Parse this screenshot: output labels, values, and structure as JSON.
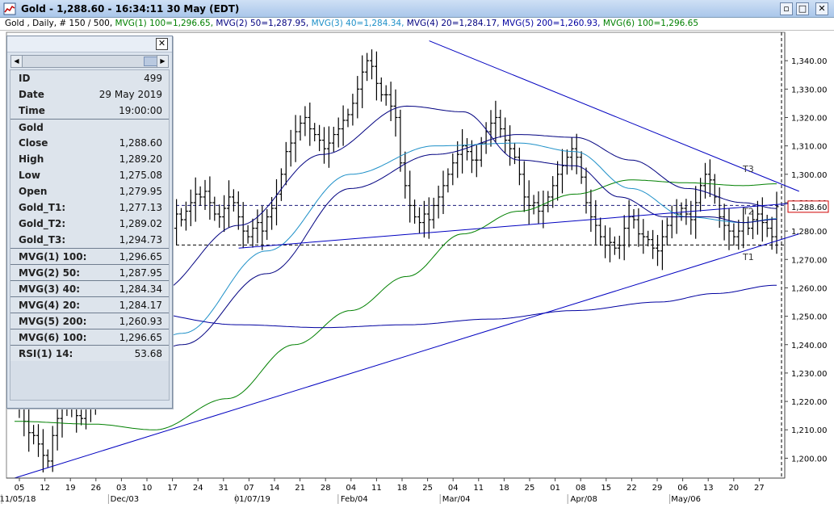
{
  "window": {
    "title": "Gold - 1,288.60 - 16:34:11  30 May (EDT)"
  },
  "legend": [
    {
      "text": "Gold , Daily, # 150 / 500, ",
      "color": "#000000"
    },
    {
      "text": "MVG(1) 100=1,296.65, ",
      "color": "#008000"
    },
    {
      "text": "MVG(2) 50=1,287.95, ",
      "color": "#000080"
    },
    {
      "text": "MVG(3) 40=1,284.34, ",
      "color": "#1e90c8"
    },
    {
      "text": "MVG(4) 20=1,284.17, ",
      "color": "#000080"
    },
    {
      "text": "MVG(5) 200=1,260.93, ",
      "color": "#0000a0"
    },
    {
      "text": "MVG(6) 100=1,296.65",
      "color": "#008000"
    }
  ],
  "data_window": {
    "rows": [
      {
        "label": "ID",
        "value": "499"
      },
      {
        "label": "Date",
        "value": "29 May 2019"
      },
      {
        "label": "Time",
        "value": "19:00:00"
      },
      {
        "label": "Gold",
        "value": "",
        "sep": true
      },
      {
        "label": "Close",
        "value": "1,288.60"
      },
      {
        "label": "High",
        "value": "1,289.20"
      },
      {
        "label": "Low",
        "value": "1,275.08"
      },
      {
        "label": "Open",
        "value": "1,279.95"
      },
      {
        "label": "Gold_T1:",
        "value": "1,277.13"
      },
      {
        "label": "Gold_T2:",
        "value": "1,289.02"
      },
      {
        "label": "Gold_T3:",
        "value": "1,294.73"
      },
      {
        "label": "MVG(1) 100:",
        "value": "1,296.65",
        "sep": true
      },
      {
        "label": "MVG(2) 50:",
        "value": "1,287.95",
        "sep": true
      },
      {
        "label": "MVG(3) 40:",
        "value": "1,284.34",
        "sep": true
      },
      {
        "label": "MVG(4) 20:",
        "value": "1,284.17",
        "sep": true
      },
      {
        "label": "MVG(5) 200:",
        "value": "1,260.93",
        "sep": true
      },
      {
        "label": "MVG(6) 100:",
        "value": "1,296.65",
        "sep": true
      },
      {
        "label": "RSI(1) 14:",
        "value": "53.68",
        "sep": true
      }
    ]
  },
  "chart_data": {
    "type": "candlestick-bar",
    "ylim": [
      1193,
      1350
    ],
    "yticks": [
      1200,
      1210,
      1220,
      1230,
      1240,
      1250,
      1260,
      1270,
      1280,
      1290,
      1300,
      1310,
      1320,
      1330,
      1340
    ],
    "ytick_labels": [
      "1,200.00",
      "1,210.00",
      "1,220.00",
      "1,230.00",
      "1,240.00",
      "1,250.00",
      "1,260.00",
      "1,270.00",
      "1,280.00",
      "1,290.00",
      "1,300.00",
      "1,310.00",
      "1,320.00",
      "1,330.00",
      "1,340.00"
    ],
    "last_price": 1288.6,
    "last_price_label": "1,288.60",
    "hlines": [
      1289.02,
      1275.08
    ],
    "xtick_labels": [
      "05",
      "12",
      "19",
      "26",
      "03",
      "10",
      "17",
      "24",
      "31",
      "07",
      "14",
      "21",
      "28",
      "04",
      "11",
      "18",
      "25",
      "04",
      "11",
      "18",
      "25",
      "01",
      "08",
      "15",
      "22",
      "29",
      "06",
      "13",
      "20",
      "27"
    ],
    "month_labels": [
      {
        "text": "11/05/18",
        "after_tick": 0
      },
      {
        "text": "Dec/03",
        "after_tick": 4
      },
      {
        "text": "01/07/19",
        "after_tick": 9
      },
      {
        "text": "Feb/04",
        "after_tick": 13
      },
      {
        "text": "Mar/04",
        "after_tick": 17
      },
      {
        "text": "Apr/08",
        "after_tick": 22
      },
      {
        "text": "May/06",
        "after_tick": 26
      }
    ],
    "annotations": [
      {
        "text": "T1",
        "price": 1271
      },
      {
        "text": "T2",
        "price": 1287
      },
      {
        "text": "T3",
        "price": 1302
      }
    ],
    "closes": [
      1225,
      1218,
      1213,
      1209,
      1208,
      1205,
      1201,
      1199,
      1208,
      1214,
      1218,
      1222,
      1219,
      1215,
      1214,
      1218,
      1222,
      1227,
      1230,
      1233,
      1236,
      1240,
      1243,
      1246,
      1244,
      1248,
      1253,
      1258,
      1262,
      1266,
      1270,
      1272,
      1275,
      1281,
      1286,
      1284,
      1287,
      1290,
      1293,
      1292,
      1294,
      1290,
      1286,
      1285,
      1288,
      1292,
      1290,
      1285,
      1280,
      1278,
      1281,
      1283,
      1280,
      1285,
      1288,
      1293,
      1300,
      1308,
      1311,
      1315,
      1318,
      1320,
      1316,
      1314,
      1312,
      1309,
      1311,
      1314,
      1316,
      1319,
      1321,
      1325,
      1330,
      1336,
      1340,
      1338,
      1332,
      1328,
      1328,
      1324,
      1320,
      1304,
      1296,
      1289,
      1285,
      1283,
      1286,
      1284,
      1289,
      1292,
      1296,
      1300,
      1304,
      1307,
      1310,
      1308,
      1305,
      1305,
      1311,
      1315,
      1318,
      1320,
      1316,
      1312,
      1309,
      1306,
      1300,
      1292,
      1289,
      1290,
      1287,
      1289,
      1292,
      1296,
      1300,
      1303,
      1306,
      1309,
      1306,
      1299,
      1290,
      1285,
      1282,
      1278,
      1275,
      1276,
      1274,
      1275,
      1281,
      1285,
      1284,
      1279,
      1278,
      1277,
      1274,
      1273,
      1278,
      1282,
      1285,
      1286,
      1288,
      1286,
      1284,
      1290,
      1296,
      1300,
      1298,
      1292,
      1285,
      1282,
      1280,
      1278,
      1280,
      1283,
      1281,
      1284,
      1286,
      1283,
      1281,
      1278,
      1288.6
    ],
    "series": [
      {
        "name": "MVG(1) 100",
        "color": "#008000",
        "anchors": [
          [
            0,
            1213
          ],
          [
            14,
            1212
          ],
          [
            25,
            1210
          ],
          [
            38,
            1221
          ],
          [
            50,
            1240
          ],
          [
            60,
            1252
          ],
          [
            70,
            1264
          ],
          [
            80,
            1279
          ],
          [
            90,
            1287
          ],
          [
            100,
            1293
          ],
          [
            110,
            1298
          ],
          [
            120,
            1297
          ],
          [
            130,
            1296
          ],
          [
            136,
            1296.65
          ]
        ]
      },
      {
        "name": "MVG(2) 50",
        "color": "#000080",
        "anchors": [
          [
            0,
            1220
          ],
          [
            15,
            1222
          ],
          [
            30,
            1240
          ],
          [
            45,
            1265
          ],
          [
            60,
            1295
          ],
          [
            75,
            1307
          ],
          [
            90,
            1314
          ],
          [
            100,
            1313
          ],
          [
            110,
            1305
          ],
          [
            120,
            1295
          ],
          [
            130,
            1290
          ],
          [
            136,
            1287.95
          ]
        ]
      },
      {
        "name": "MVG(3) 40",
        "color": "#1e90c8",
        "anchors": [
          [
            0,
            1224
          ],
          [
            15,
            1225
          ],
          [
            30,
            1244
          ],
          [
            45,
            1273
          ],
          [
            60,
            1300
          ],
          [
            75,
            1310
          ],
          [
            90,
            1311
          ],
          [
            100,
            1308
          ],
          [
            110,
            1295
          ],
          [
            120,
            1285
          ],
          [
            130,
            1283
          ],
          [
            136,
            1284.34
          ]
        ]
      },
      {
        "name": "MVG(4) 20",
        "color": "#000080",
        "anchors": [
          [
            0,
            1230
          ],
          [
            10,
            1235
          ],
          [
            25,
            1258
          ],
          [
            40,
            1282
          ],
          [
            55,
            1307
          ],
          [
            70,
            1324
          ],
          [
            80,
            1322
          ],
          [
            90,
            1305
          ],
          [
            100,
            1303
          ],
          [
            108,
            1292
          ],
          [
            116,
            1285
          ],
          [
            124,
            1285
          ],
          [
            130,
            1283
          ],
          [
            136,
            1284.17
          ]
        ]
      },
      {
        "name": "MVG(5) 200",
        "color": "#0000a0",
        "anchors": [
          [
            0,
            1254
          ],
          [
            20,
            1252
          ],
          [
            40,
            1247
          ],
          [
            55,
            1246
          ],
          [
            70,
            1247
          ],
          [
            85,
            1249
          ],
          [
            100,
            1252
          ],
          [
            115,
            1255
          ],
          [
            125,
            1258
          ],
          [
            136,
            1260.93
          ]
        ]
      }
    ],
    "trendlines": [
      {
        "from": [
          0,
          1193
        ],
        "to": [
          140,
          1279
        ],
        "color": "#0000c0"
      },
      {
        "from": [
          40,
          1274
        ],
        "to": [
          140,
          1290
        ],
        "color": "#0000c0"
      },
      {
        "from": [
          74,
          1347
        ],
        "to": [
          140,
          1294
        ],
        "color": "#0000c0"
      }
    ]
  }
}
